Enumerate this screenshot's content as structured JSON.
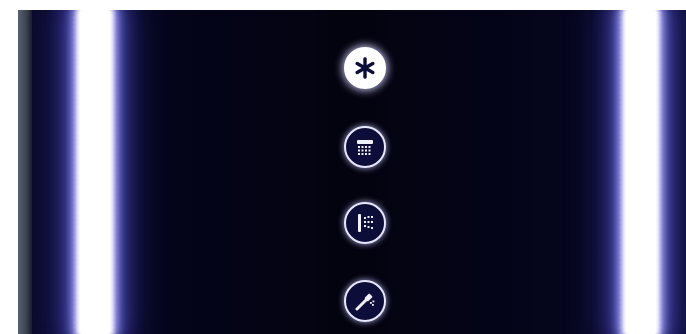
{
  "panel": {
    "background": "#05051c",
    "light_color": "#ffffff",
    "glow_color": "#5a5ad0"
  },
  "controls": [
    {
      "icon": "asterisk-icon",
      "active": true
    },
    {
      "icon": "rain-shower-icon",
      "active": false
    },
    {
      "icon": "side-jets-icon",
      "active": false
    },
    {
      "icon": "hand-shower-icon",
      "active": false
    }
  ]
}
